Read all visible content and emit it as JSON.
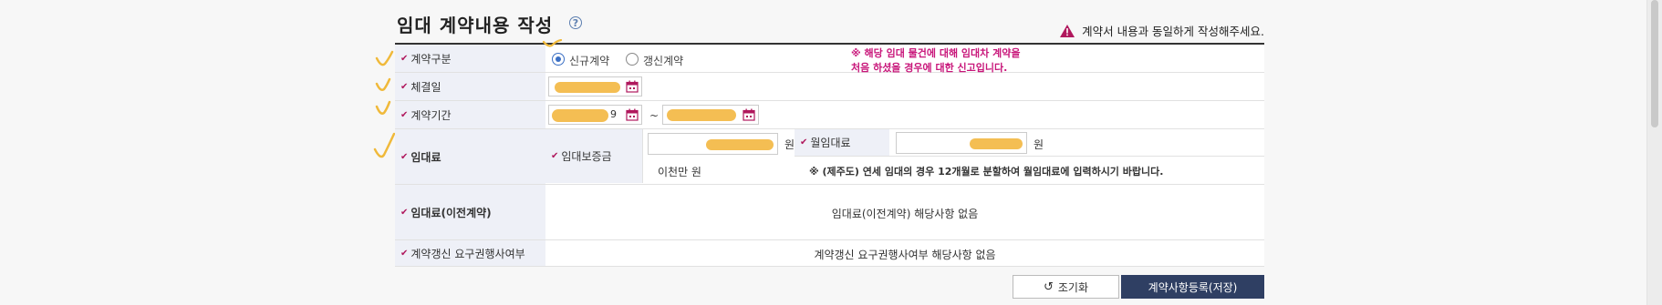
{
  "header": {
    "title": "임대 계약내용 작성",
    "help_icon_glyph": "?",
    "notice": "계약서 내용과 동일하게 작성해주세요."
  },
  "rows": {
    "contract_type": {
      "label": "계약구분",
      "options": [
        {
          "label": "신규계약",
          "selected": true
        },
        {
          "label": "갱신계약",
          "selected": false
        }
      ],
      "note_line1": "※ 해당 임대 물건에 대해 임대차 계약을",
      "note_line2": "처음 하셨을 경우에 대한 신고입니다."
    },
    "signing_date": {
      "label": "체결일"
    },
    "period": {
      "label": "계약기간",
      "separator": "~",
      "start_partial": "9"
    },
    "rent": {
      "label": "임대료",
      "deposit_label": "임대보증금",
      "deposit_unit": "원",
      "deposit_text": "이천만 원",
      "monthly_label": "월임대료",
      "monthly_unit": "원",
      "note": "※ (제주도) 연세 임대의 경우 12개월로 분할하여 월임대료에 입력하시기 바랍니다."
    },
    "prev_rent": {
      "label": "임대료(이전계약)",
      "value": "임대료(이전계약) 해당사항 없음"
    },
    "renewal_right": {
      "label": "계약갱신 요구권행사여부",
      "value": "계약갱신 요구권행사여부 해당사항 없음"
    }
  },
  "buttons": {
    "reset": "조기화",
    "save": "계약사항등록(저장)"
  },
  "colors": {
    "accent": "#2f3f63",
    "check_mark": "#b0185d",
    "note_pink": "#c8167a",
    "label_bg": "#eef0f7",
    "highlight": "#f3bb4a"
  }
}
